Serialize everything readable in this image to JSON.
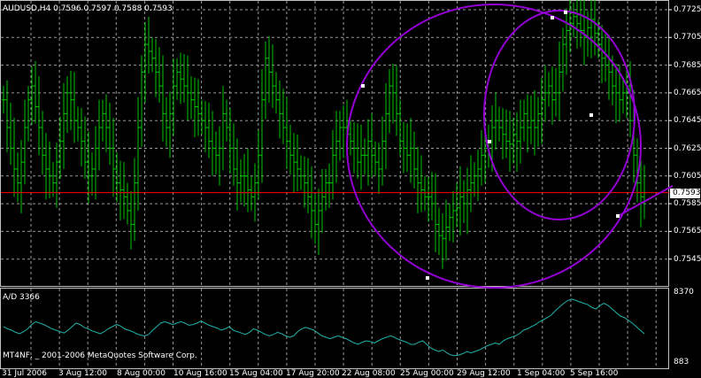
{
  "symbol_header": "AUDUSD,H4  0.7596 0.7597 0.7588 0.7593",
  "indicator_header": "A/D 3366",
  "copyright": "MT4NF, _ 2001-2006 MetaQuotes Software Corp.",
  "current_price": "0.7593",
  "price_axis": [
    "0.7725",
    "0.7705",
    "0.7685",
    "0.7665",
    "0.7645",
    "0.7625",
    "0.7605",
    "0.7585",
    "0.7565",
    "0.7545"
  ],
  "indicator_axis": [
    "8370",
    "883"
  ],
  "time_axis": [
    "31 Jul 2006",
    "3 Aug 12:00",
    "8 Aug 00:00",
    "10 Aug 16:00",
    "15 Aug 04:00",
    "17 Aug 20:00",
    "22 Aug 08:00",
    "25 Aug 00:00",
    "29 Aug 12:00",
    "1 Sep 04:00",
    "5 Sep 16:00"
  ],
  "colors": {
    "background": "#000000",
    "bars": "#00c800",
    "grid": "#c0c0c0",
    "price_line": "#ff0000",
    "circles": "#9400d3",
    "indicator_line": "#20b2aa"
  },
  "chart_data": {
    "type": "bar",
    "title": "AUDUSD,H4",
    "ylim": [
      0.754,
      0.773
    ],
    "last_close": 0.7593,
    "closes": [
      0.766,
      0.764,
      0.7625,
      0.761,
      0.76,
      0.7615,
      0.764,
      0.766,
      0.767,
      0.7655,
      0.764,
      0.762,
      0.761,
      0.7605,
      0.76,
      0.7615,
      0.763,
      0.765,
      0.7665,
      0.766,
      0.7645,
      0.764,
      0.763,
      0.7615,
      0.7605,
      0.761,
      0.7625,
      0.764,
      0.765,
      0.764,
      0.7625,
      0.761,
      0.76,
      0.7595,
      0.759,
      0.758,
      0.757,
      0.76,
      0.764,
      0.768,
      0.77,
      0.7695,
      0.769,
      0.768,
      0.767,
      0.765,
      0.764,
      0.765,
      0.767,
      0.768,
      0.7675,
      0.767,
      0.7665,
      0.766,
      0.7655,
      0.765,
      0.7645,
      0.764,
      0.763,
      0.7625,
      0.762,
      0.7625,
      0.765,
      0.764,
      0.7625,
      0.761,
      0.76,
      0.7605,
      0.7605,
      0.7595,
      0.759,
      0.76,
      0.762,
      0.766,
      0.769,
      0.768,
      0.767,
      0.766,
      0.765,
      0.764,
      0.763,
      0.762,
      0.7615,
      0.761,
      0.7605,
      0.76,
      0.759,
      0.758,
      0.757,
      0.758,
      0.759,
      0.76,
      0.76,
      0.762,
      0.763,
      0.764,
      0.764,
      0.7635,
      0.763,
      0.7625,
      0.7615,
      0.762,
      0.762,
      0.763,
      0.762,
      0.7615,
      0.761,
      0.763,
      0.765,
      0.767,
      0.7665,
      0.765,
      0.763,
      0.7625,
      0.762,
      0.7625,
      0.761,
      0.76,
      0.7595,
      0.759,
      0.759,
      0.7585,
      0.757,
      0.7562,
      0.756,
      0.7568,
      0.7575,
      0.758,
      0.7582,
      0.759,
      0.7585,
      0.7595,
      0.76,
      0.7605,
      0.761,
      0.762,
      0.7625,
      0.763,
      0.764,
      0.7645,
      0.764,
      0.7635,
      0.763,
      0.7628,
      0.7635,
      0.763,
      0.764,
      0.765,
      0.764,
      0.7645,
      0.764,
      0.765,
      0.766,
      0.7665,
      0.767,
      0.766,
      0.7665,
      0.768,
      0.77,
      0.771,
      0.7715,
      0.772,
      0.7715,
      0.771,
      0.7705,
      0.7712,
      0.7718,
      0.7708,
      0.77,
      0.769,
      0.7685,
      0.768,
      0.767,
      0.7665,
      0.766,
      0.7665,
      0.767,
      0.7645,
      0.762,
      0.76,
      0.759,
      0.7593
    ]
  },
  "indicator_data": [
    0.55,
    0.52,
    0.5,
    0.47,
    0.45,
    0.48,
    0.52,
    0.58,
    0.62,
    0.6,
    0.58,
    0.55,
    0.52,
    0.5,
    0.48,
    0.46,
    0.5,
    0.55,
    0.6,
    0.58,
    0.54,
    0.52,
    0.49,
    0.47,
    0.45,
    0.48,
    0.52,
    0.55,
    0.58,
    0.56,
    0.52,
    0.5,
    0.48,
    0.45,
    0.43,
    0.42,
    0.44,
    0.5,
    0.55,
    0.6,
    0.62,
    0.6,
    0.58,
    0.6,
    0.62,
    0.6,
    0.57,
    0.58,
    0.6,
    0.63,
    0.6,
    0.57,
    0.55,
    0.53,
    0.5,
    0.52,
    0.55,
    0.5,
    0.48,
    0.46,
    0.44,
    0.47,
    0.52,
    0.5,
    0.47,
    0.44,
    0.42,
    0.44,
    0.47,
    0.45,
    0.42,
    0.4,
    0.42,
    0.48,
    0.52,
    0.54,
    0.52,
    0.5,
    0.46,
    0.42,
    0.4,
    0.38,
    0.4,
    0.42,
    0.4,
    0.38,
    0.35,
    0.32,
    0.3,
    0.33,
    0.35,
    0.34,
    0.32,
    0.35,
    0.38,
    0.4,
    0.42,
    0.4,
    0.37,
    0.35,
    0.33,
    0.3,
    0.3,
    0.33,
    0.35,
    0.3,
    0.25,
    0.22,
    0.2,
    0.22,
    0.18,
    0.15,
    0.14,
    0.15,
    0.17,
    0.2,
    0.18,
    0.2,
    0.22,
    0.25,
    0.28,
    0.3,
    0.32,
    0.3,
    0.35,
    0.38,
    0.4,
    0.42,
    0.45,
    0.5,
    0.52,
    0.55,
    0.58,
    0.62,
    0.65,
    0.68,
    0.72,
    0.78,
    0.83,
    0.88,
    0.92,
    0.94,
    0.92,
    0.9,
    0.88,
    0.86,
    0.82,
    0.8,
    0.85,
    0.88,
    0.85,
    0.8,
    0.75,
    0.7,
    0.68,
    0.64,
    0.6,
    0.55,
    0.5,
    0.45
  ]
}
